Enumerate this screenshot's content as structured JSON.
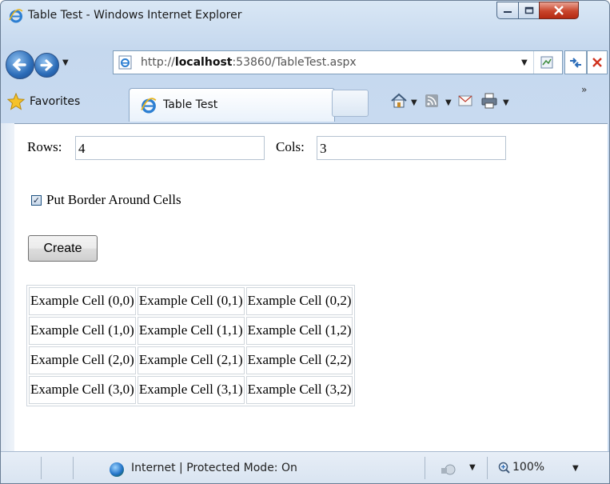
{
  "window": {
    "title": "Table Test - Windows Internet Explorer"
  },
  "address_bar": {
    "url_prefix": "http://",
    "url_host": "localhost",
    "url_rest": ":53860/TableTest.aspx"
  },
  "favorites_bar": {
    "favorites_label": "Favorites"
  },
  "tab": {
    "label": "Table Test"
  },
  "form": {
    "rows_label": "Rows:",
    "rows_value": "4",
    "cols_label": "Cols:",
    "cols_value": "3",
    "border_checkbox_label": "Put Border Around Cells",
    "border_checked": true,
    "create_button_label": "Create"
  },
  "table": {
    "rows": [
      [
        "Example Cell (0,0)",
        "Example Cell (0,1)",
        "Example Cell (0,2)"
      ],
      [
        "Example Cell (1,0)",
        "Example Cell (1,1)",
        "Example Cell (1,2)"
      ],
      [
        "Example Cell (2,0)",
        "Example Cell (2,1)",
        "Example Cell (2,2)"
      ],
      [
        "Example Cell (3,0)",
        "Example Cell (3,1)",
        "Example Cell (3,2)"
      ]
    ]
  },
  "status_bar": {
    "zone_text": "Internet | Protected Mode: On",
    "zoom": "100%"
  },
  "icons": {
    "ie": "internet-explorer-icon",
    "favorites_star": "star-icon",
    "home": "home-icon",
    "feeds": "rss-feed-icon",
    "mail": "mail-icon",
    "print": "print-icon",
    "refresh": "refresh-icon",
    "stop": "stop-icon",
    "compat": "compatibility-view-icon"
  },
  "colors": {
    "chrome": "#c8daf0",
    "close_button": "#c8442b",
    "link_blue": "#2b6cb8"
  }
}
